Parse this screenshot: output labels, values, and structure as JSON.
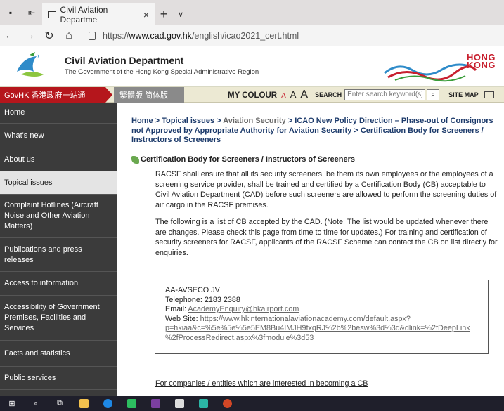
{
  "browser": {
    "tab_title": "Civil Aviation Departme",
    "tab_close": "×",
    "new_tab": "+",
    "tab_menu": "∨",
    "url_prefix": "https://",
    "url_host": "www.cad.gov.hk",
    "url_path": "/english/icao2021_cert.html"
  },
  "header": {
    "title": "Civil Aviation Department",
    "subtitle": "The Government of the Hong Kong Special Administrative Region",
    "brand_line1": "HONG",
    "brand_line2": "KONG"
  },
  "strip": {
    "govhk": "GovHK 香港政府一站通",
    "lang": "繁體版  简体版",
    "my_colour": "MY COLOUR",
    "a_small": "A",
    "a_medium": "A",
    "a_large": "A",
    "search_label": "SEARCH",
    "search_placeholder": "Enter search keyword(s)",
    "sitemap": "SITE MAP"
  },
  "sidebar": {
    "items": [
      {
        "label": "Home"
      },
      {
        "label": "What's new"
      },
      {
        "label": "About us"
      },
      {
        "label": "Topical issues"
      },
      {
        "label": "Complaint Hotlines (Aircraft Noise and Other Aviation Matters)"
      },
      {
        "label": "Publications and press releases"
      },
      {
        "label": "Access to information"
      },
      {
        "label": "Accessibility of Government Premises, Facilities and Services"
      },
      {
        "label": "Facts and statistics"
      },
      {
        "label": "Public services"
      }
    ]
  },
  "breadcrumb": {
    "home": "Home",
    "sep": " > ",
    "topical": "Topical issues",
    "aviation_security": "Aviation Security",
    "icao": "ICAO New Policy Direction – Phase-out of Consignors not Approved by Appropriate Authority for Aviation Security",
    "current": "Certification Body for Screeners / Instructors of Screeners"
  },
  "content": {
    "section_title": "Certification Body for Screeners / Instructors of Screeners",
    "para1": "RACSF shall ensure that all its security screeners, be them its own employees or the employees of a screening service provider, shall be trained and certified by a Certification Body (CB) acceptable to Civil Aviation Department (CAD) before such screeners are allowed to perform the screening duties of air cargo in the RACSF premises.",
    "para2": "The following is a list of CB accepted by the CAD. (Note: The list would be updated whenever there are changes.  Please check this page from time to time for updates.) For training and certification of security screeners for RACSF, applicants of the RACSF Scheme can contact the CB on list directly for enquiries.",
    "cb_name": "AA-AVSECO JV",
    "cb_phone": "Telephone: 2183 2388",
    "cb_email_label": "Email: ",
    "cb_email": "AcademyEnquiry@hkairport.com",
    "cb_web_label": "Web Site: ",
    "cb_web_line1": "https://www.hkinternationalaviationacademy.com/default.aspx?",
    "cb_web_line2": "p=hkiaa&c=%5e%5e%5e5EM8Bu4IMJH9fxqRJ%2b%2besw%3d%3d&dlink=%2fDeepLink",
    "cb_web_line3": "%2fProcessRedirect.aspx%3fmodule%3d53",
    "interest_link": "For companies / entities which are interested in becoming a CB"
  },
  "colors": {
    "sidebar_bg": "#3b3b3b",
    "govhk_red": "#b5161c",
    "link_blue": "#1d3b6b",
    "strip_bg": "#ece9d3"
  }
}
